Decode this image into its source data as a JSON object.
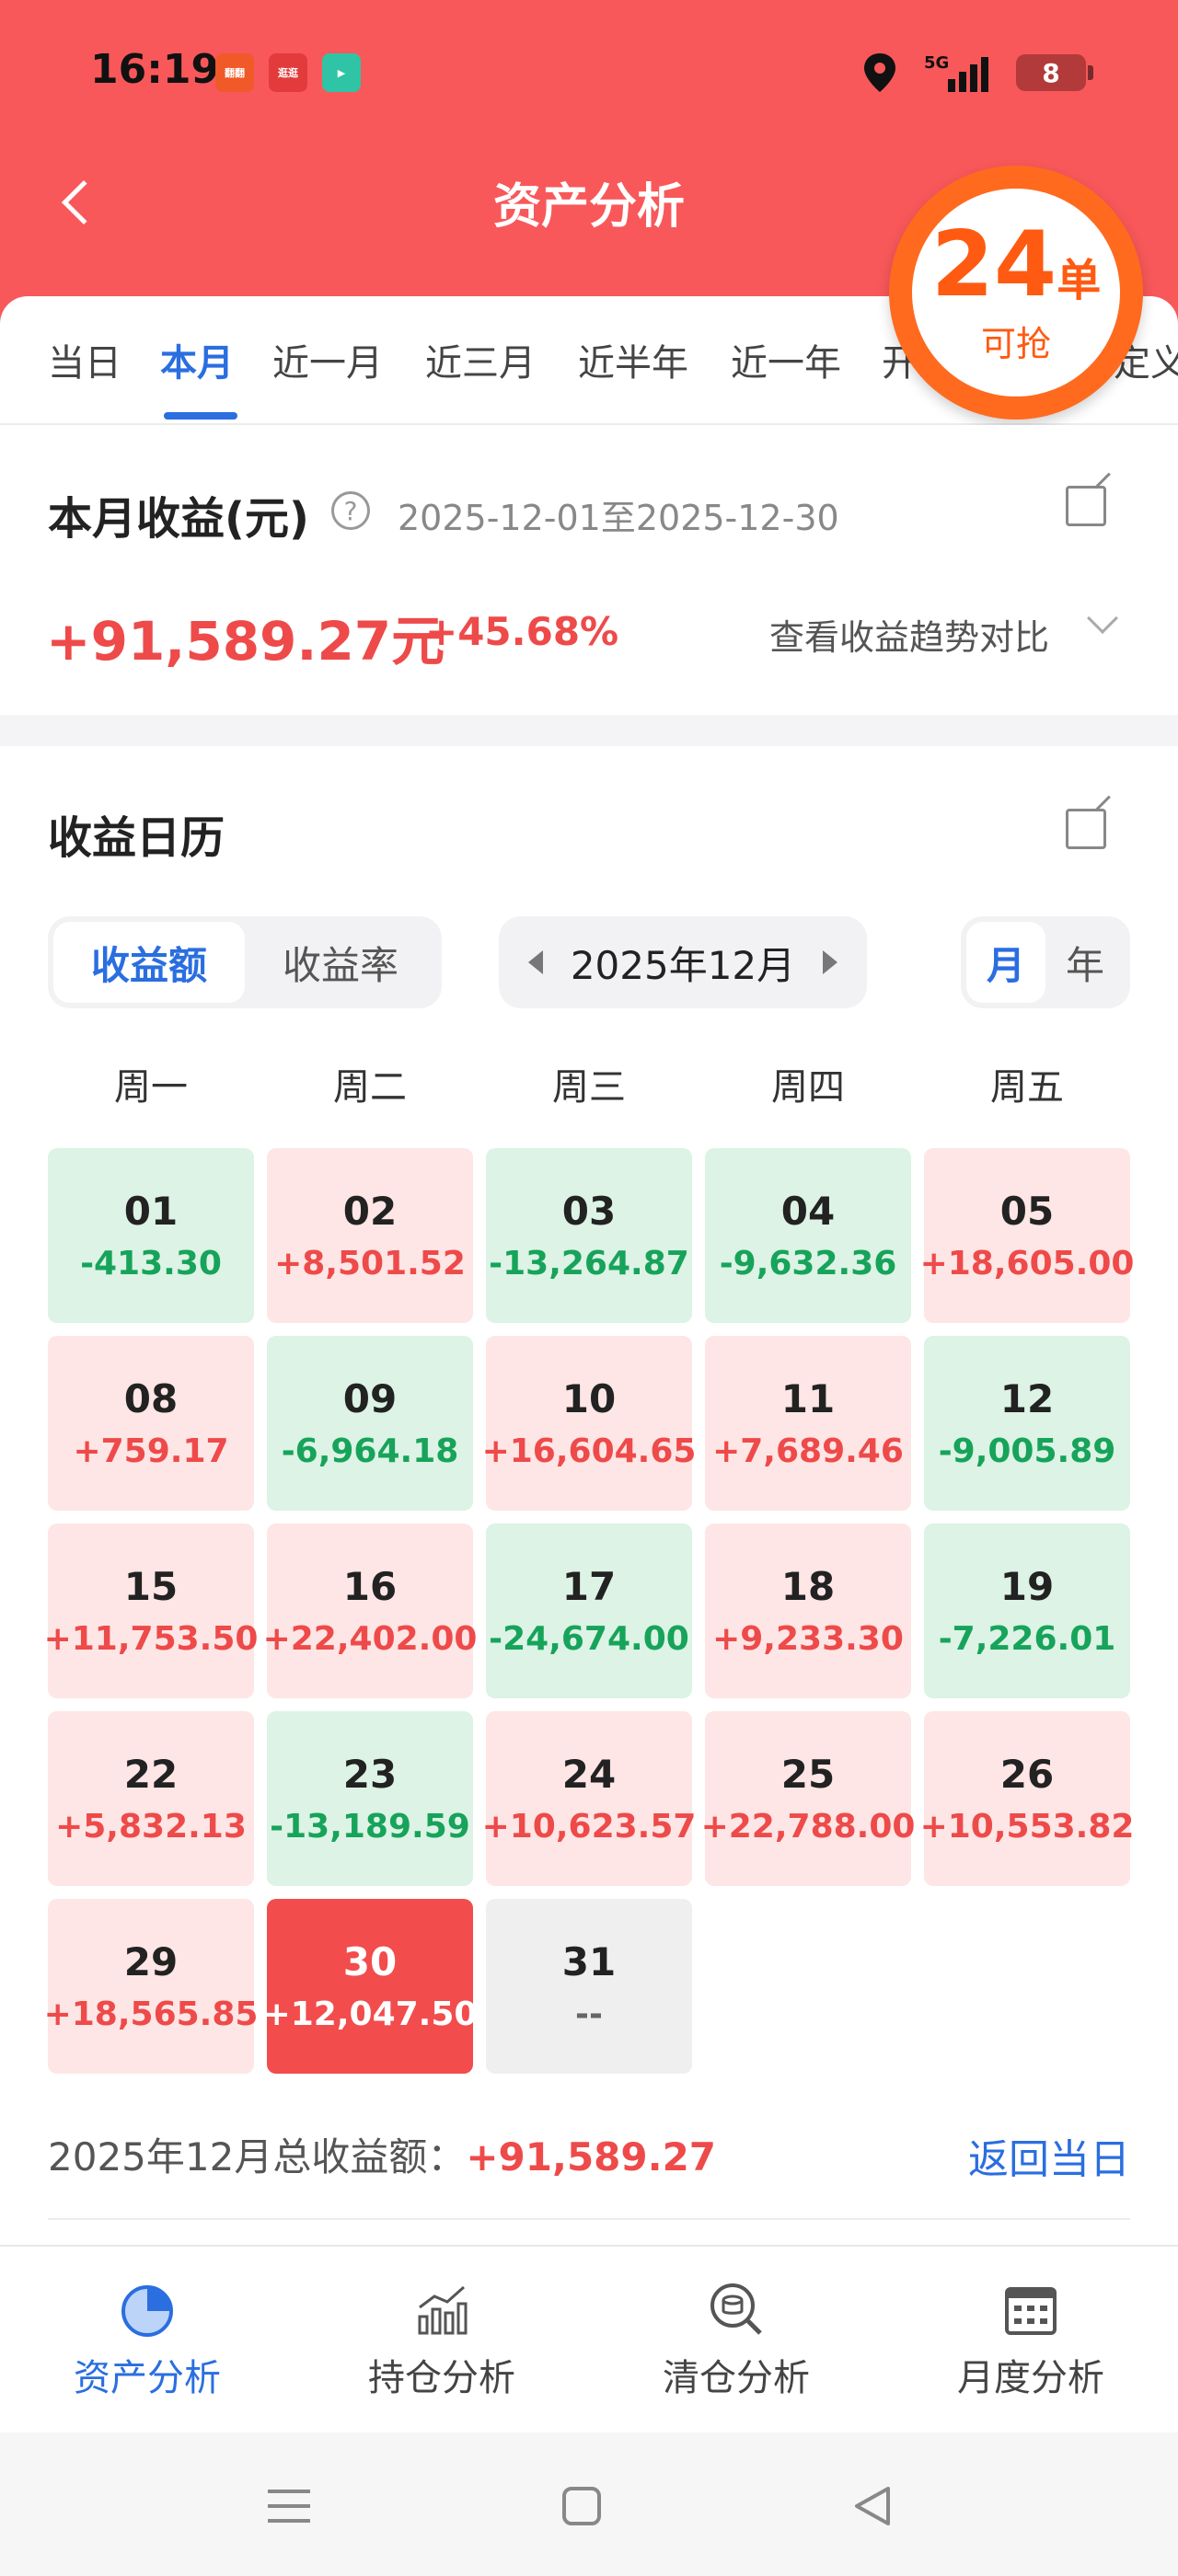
{
  "status_bar": {
    "time": "16:19",
    "network": "5G",
    "battery": "8",
    "mini_apps": [
      {
        "label": "翻翻",
        "color": "#f05a28"
      },
      {
        "label": "逛逛",
        "color": "#e33b3b"
      },
      {
        "label": "▶",
        "color": "#2ec4a5"
      }
    ]
  },
  "header": {
    "title": "资产分析",
    "back_icon": "chevron-left-icon",
    "color": "#f8585a"
  },
  "tabs": [
    "当日",
    "本月",
    "近一月",
    "近三月",
    "近半年",
    "近一年",
    "开",
    "定义"
  ],
  "active_tab": 1,
  "promo": {
    "count": "24",
    "unit": "单",
    "label": "可抢"
  },
  "summary": {
    "title": "本月收益(元)",
    "date_range": "2025-12-01至2025-12-30",
    "amount": "+91,589.27元",
    "percent": "+45.68%",
    "trend_link": "查看收益趋势对比"
  },
  "calendar": {
    "title": "收益日历",
    "toggle": [
      "收益额",
      "收益率"
    ],
    "toggle_active": 0,
    "month": "2025年12月",
    "period": [
      "月",
      "年"
    ],
    "period_active": 0,
    "weekdays": [
      "周一",
      "周二",
      "周三",
      "周四",
      "周五"
    ],
    "days": [
      {
        "day": "01",
        "value": "-413.30",
        "type": "neg"
      },
      {
        "day": "02",
        "value": "+8,501.52",
        "type": "pos"
      },
      {
        "day": "03",
        "value": "-13,264.87",
        "type": "neg"
      },
      {
        "day": "04",
        "value": "-9,632.36",
        "type": "neg"
      },
      {
        "day": "05",
        "value": "+18,605.00",
        "type": "pos"
      },
      {
        "day": "08",
        "value": "+759.17",
        "type": "pos"
      },
      {
        "day": "09",
        "value": "-6,964.18",
        "type": "neg"
      },
      {
        "day": "10",
        "value": "+16,604.65",
        "type": "pos"
      },
      {
        "day": "11",
        "value": "+7,689.46",
        "type": "pos"
      },
      {
        "day": "12",
        "value": "-9,005.89",
        "type": "neg"
      },
      {
        "day": "15",
        "value": "+11,753.50",
        "type": "pos"
      },
      {
        "day": "16",
        "value": "+22,402.00",
        "type": "pos"
      },
      {
        "day": "17",
        "value": "-24,674.00",
        "type": "neg"
      },
      {
        "day": "18",
        "value": "+9,233.30",
        "type": "pos"
      },
      {
        "day": "19",
        "value": "-7,226.01",
        "type": "neg"
      },
      {
        "day": "22",
        "value": "+5,832.13",
        "type": "pos"
      },
      {
        "day": "23",
        "value": "-13,189.59",
        "type": "neg"
      },
      {
        "day": "24",
        "value": "+10,623.57",
        "type": "pos"
      },
      {
        "day": "25",
        "value": "+22,788.00",
        "type": "pos"
      },
      {
        "day": "26",
        "value": "+10,553.82",
        "type": "pos"
      },
      {
        "day": "29",
        "value": "+18,565.85",
        "type": "pos"
      },
      {
        "day": "30",
        "value": "+12,047.50",
        "type": "today"
      },
      {
        "day": "31",
        "value": "--",
        "type": "empty"
      }
    ],
    "footer_label": "2025年12月总收益额：",
    "footer_total": "+91,589.27",
    "back_today": "返回当日"
  },
  "bottom_nav": [
    {
      "label": "资产分析",
      "icon": "pie-chart-icon"
    },
    {
      "label": "持仓分析",
      "icon": "bar-trend-icon"
    },
    {
      "label": "清仓分析",
      "icon": "coin-search-icon"
    },
    {
      "label": "月度分析",
      "icon": "calendar-icon"
    }
  ],
  "bottom_nav_active": 0,
  "colors": {
    "accent": "#2a6ee0",
    "gain": "#ee4a4a",
    "loss": "#17a35a",
    "gain_bg": "#fde6e5",
    "loss_bg": "#dcf3e5",
    "promo": "#ff5a12"
  }
}
